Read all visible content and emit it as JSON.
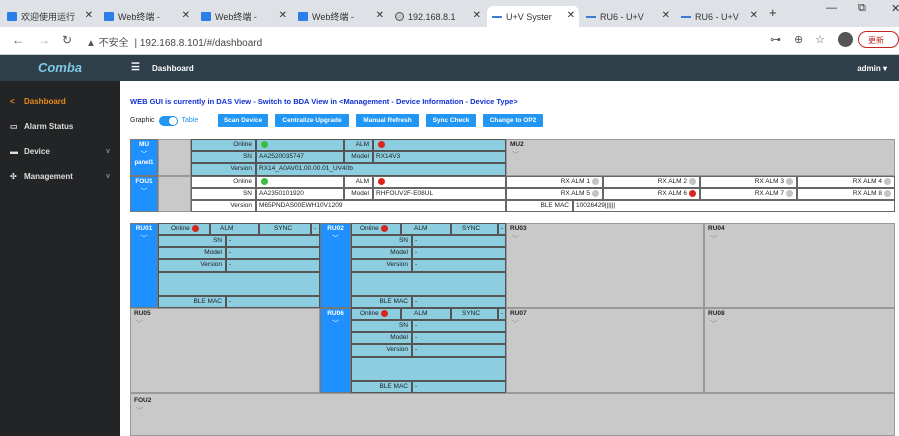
{
  "browser": {
    "tabs": [
      {
        "icon": "m",
        "label": "欢迎使用运行",
        "active": false
      },
      {
        "icon": "m",
        "label": "Web终端 - ",
        "active": false
      },
      {
        "icon": "m",
        "label": "Web终端 - ",
        "active": false
      },
      {
        "icon": "m",
        "label": "Web终端 - ",
        "active": false
      },
      {
        "icon": "g",
        "label": "192.168.8.1",
        "active": false
      },
      {
        "icon": "d",
        "label": "U+V Syster",
        "active": true
      },
      {
        "icon": "d",
        "label": "RU6 - U+V",
        "active": false
      },
      {
        "icon": "d",
        "label": "RU6 - U+V",
        "active": false
      }
    ],
    "new_tab": "+",
    "url_warning": "▲ 不安全",
    "url": "192.168.8.101/#/dashboard",
    "update_label": "更新"
  },
  "app": {
    "logo": "Comba",
    "topbar_title": "Dashboard",
    "user": "admin",
    "sidebar": [
      {
        "label": "Dashboard",
        "icon": "share-icon",
        "active": true
      },
      {
        "label": "Alarm Status",
        "icon": "monitor-icon",
        "active": false
      },
      {
        "label": "Device",
        "icon": "device-icon",
        "active": false
      },
      {
        "label": "Management",
        "icon": "gear-icon",
        "active": false
      }
    ],
    "notice": "WEB GUI is currently in DAS View - Switch to BDA View in <Management - Device Information - Device Type>",
    "view_toggle": {
      "left": "Graphic",
      "right": "Table"
    },
    "buttons": [
      "Scan Device",
      "Centralize Upgrade",
      "Manual Refresh",
      "Sync Check",
      "Change to OP2"
    ]
  },
  "labels": {
    "online": "Online",
    "alm": "ALM",
    "sync": "SYNC",
    "sn": "SN",
    "model": "Model",
    "version": "Version",
    "ble_mac": "BLE MAC",
    "dash": "-"
  },
  "mu": {
    "name": "MU",
    "subname": "panel1",
    "sn": "AA2520035747",
    "model": "RX14V3",
    "version": "RX14_A0AV01.00.00.01_UV40b",
    "online_status": "green",
    "alm_status": "red"
  },
  "mu2": {
    "name": "MU2"
  },
  "fou1": {
    "name": "FOU1",
    "sn": "AA2350101920",
    "model": "RHFOUV2F-E08UL",
    "version": "M65PNDAS00EWH10V1209",
    "online_status": "green",
    "alm_status": "red",
    "rx_alarms": [
      {
        "label": "RX ALM 1",
        "status": "gray"
      },
      {
        "label": "RX ALM 2",
        "status": "gray"
      },
      {
        "label": "RX ALM 3",
        "status": "gray"
      },
      {
        "label": "RX ALM 4",
        "status": "gray"
      },
      {
        "label": "RX ALM 5",
        "status": "gray"
      },
      {
        "label": "RX ALM 6",
        "status": "red"
      },
      {
        "label": "RX ALM 7",
        "status": "gray"
      },
      {
        "label": "RX ALM 8",
        "status": "gray"
      }
    ],
    "ble_mac": "10026429||||||"
  },
  "ru01": {
    "name": "RU01",
    "online_status": "red"
  },
  "ru02": {
    "name": "RU02",
    "online_status": "red"
  },
  "ru03": {
    "name": "RU03"
  },
  "ru04": {
    "name": "RU04"
  },
  "ru05": {
    "name": "RU05"
  },
  "ru06": {
    "name": "RU06",
    "online_status": "red"
  },
  "ru07": {
    "name": "RU07"
  },
  "ru08": {
    "name": "RU08"
  },
  "fou2": {
    "name": "FOU2"
  },
  "colors": {
    "sidebar_bg": "#222426",
    "topbar_bg": "#2e3f49",
    "accent": "#2196f3",
    "active_menu": "#e8891c",
    "card_blue": "#8ccde0",
    "card_gray": "#c9c9c9",
    "status_green": "#3dbb3d",
    "status_red": "#d8261d",
    "status_gray": "#c4c4c4"
  }
}
